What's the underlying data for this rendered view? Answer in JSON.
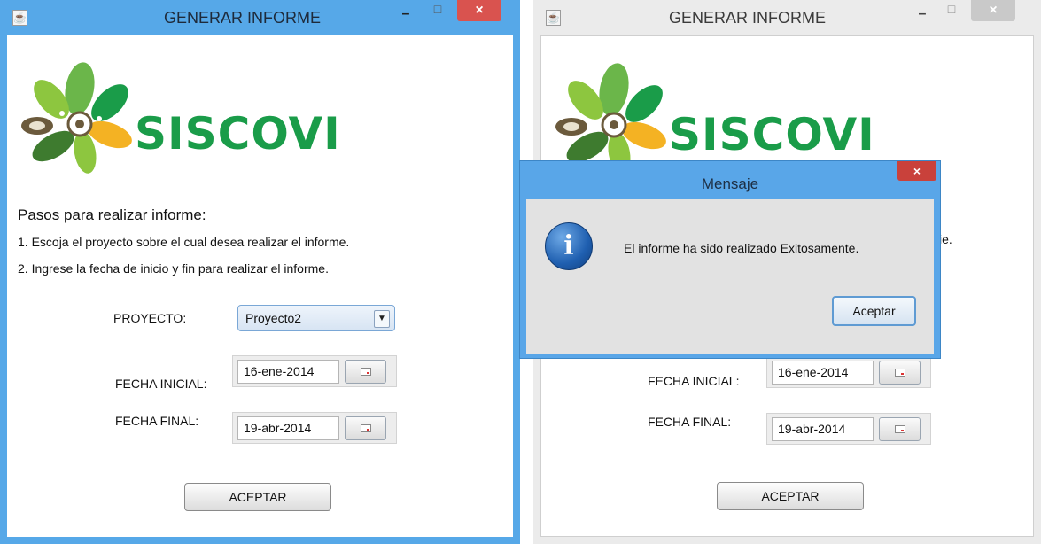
{
  "window_title": "GENERAR INFORME",
  "app_name": "SISCOVI",
  "steps_title": "Pasos para realizar informe:",
  "step1": "1. Escoja el proyecto sobre el cual desea realizar el informe.",
  "step2": "2. Ingrese la fecha de inicio y fin para realizar el informe.",
  "proyecto_label": "PROYECTO:",
  "proyecto_value": "Proyecto2",
  "fecha_inicial_label": "FECHA INICIAL:",
  "fecha_inicial_value": "16-ene-2014",
  "fecha_final_label": "FECHA FINAL:",
  "fecha_final_value": "19-abr-2014",
  "aceptar_label": "ACEPTAR",
  "dialog": {
    "title": "Mensaje",
    "message": "El informe ha sido realizado Exitosamente.",
    "button": "Aceptar",
    "close": "×"
  },
  "peek_text": "ie.",
  "titlebar": {
    "minimize": "–",
    "maximize": "□",
    "close": "×"
  },
  "icons": {
    "java": "java-icon",
    "info": "info-icon",
    "calendar": "calendar-icon",
    "dropdown": "chevron-down-icon"
  },
  "colors": {
    "accent": "#56a8e8",
    "brand_green": "#1a9c49",
    "close_red": "#d9534f"
  }
}
